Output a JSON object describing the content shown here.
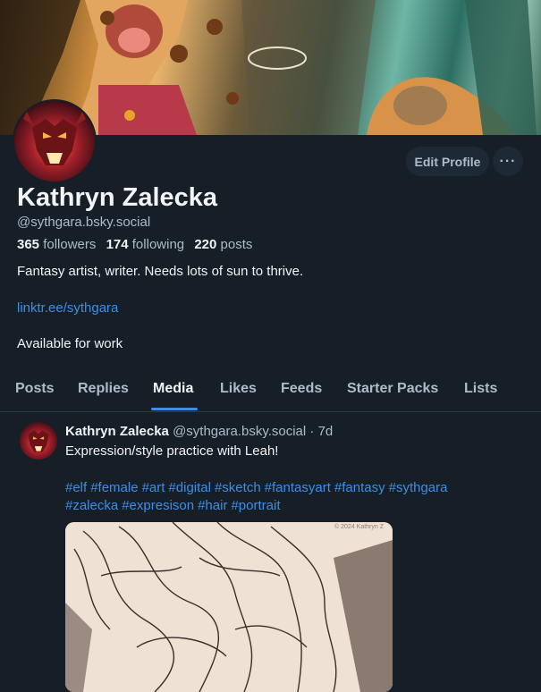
{
  "profile": {
    "display_name": "Kathryn Zalecka",
    "handle": "@sythgara.bsky.social",
    "followers_count": "365",
    "followers_label": "followers",
    "following_count": "174",
    "following_label": "following",
    "posts_count": "220",
    "posts_label": "posts",
    "bio": "Fantasy artist, writer. Needs lots of sun to thrive.",
    "link": "linktr.ee/sythgara",
    "availability": "Available for work"
  },
  "actions": {
    "edit_profile_label": "Edit Profile",
    "more_label": "···"
  },
  "tabs": [
    {
      "label": "Posts"
    },
    {
      "label": "Replies"
    },
    {
      "label": "Media",
      "active": true
    },
    {
      "label": "Likes"
    },
    {
      "label": "Feeds"
    },
    {
      "label": "Starter Packs"
    },
    {
      "label": "Lists"
    }
  ],
  "post": {
    "author_name": "Kathryn Zalecka",
    "author_handle": "@sythgara.bsky.social",
    "time_sep": " · ",
    "time": "7d",
    "text": "Expression/style practice with Leah!",
    "hashtags": [
      "#elf",
      "#female",
      "#art",
      "#digital",
      "#sketch",
      "#fantasyart",
      "#fantasy",
      "#sythgara",
      "#zalecka",
      "#expresison",
      "#hair",
      "#portrait"
    ],
    "image_watermark": "© 2024 Kathryn Z"
  },
  "colors": {
    "background": "#161e27",
    "accent": "#3b8fe8",
    "muted_text": "#aebbc9",
    "button_bg": "#1e2936"
  }
}
